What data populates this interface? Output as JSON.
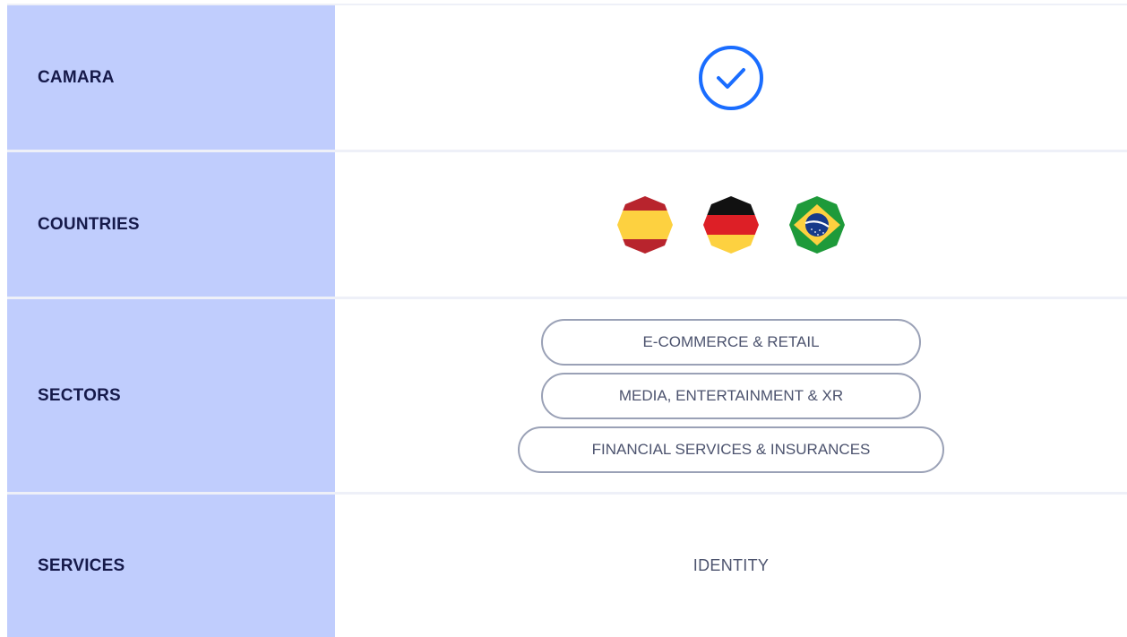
{
  "rows": {
    "camara": {
      "label": "CAMARA",
      "value_icon": "check-circle-icon",
      "check_color": "#1a6dff"
    },
    "countries": {
      "label": "COUNTRIES",
      "flags": [
        "spain-flag-icon",
        "germany-flag-icon",
        "brazil-flag-icon"
      ]
    },
    "sectors": {
      "label": "SECTORS",
      "items": [
        "E-COMMERCE & RETAIL",
        "MEDIA, ENTERTAINMENT & XR",
        "FINANCIAL SERVICES & INSURANCES"
      ]
    },
    "services": {
      "label": "SERVICES",
      "value": "IDENTITY"
    }
  },
  "colors": {
    "label_background": "#c0cdfd",
    "label_text": "#161a4a",
    "pill_border": "#9aa1b6",
    "value_text": "#4c536e"
  }
}
